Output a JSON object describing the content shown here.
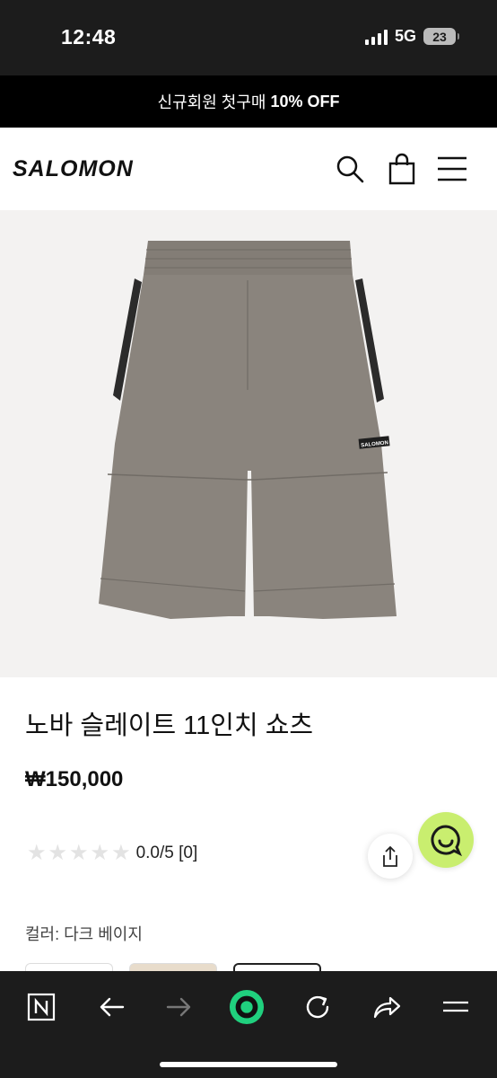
{
  "status_bar": {
    "time": "12:48",
    "network": "5G",
    "battery": "23"
  },
  "promo": {
    "text_ko": "신규회원 첫구매 ",
    "text_bold": "10% OFF"
  },
  "header": {
    "logo": "SALOMON",
    "icons": [
      "search-icon",
      "shopping-bag-icon",
      "menu-icon"
    ]
  },
  "product": {
    "image_logo": "SALOMON",
    "title": "노바 슬레이트 11인치 쇼츠",
    "price": "₩150,000",
    "rating": {
      "value": 0.0,
      "max": 5,
      "text": "0.0/5 [0]"
    },
    "color_label": "컬러: 다크 베이지"
  },
  "colors": {
    "brand_green": "#c9ee6f",
    "dark_bar": "#1c1c1c",
    "shorts_gray": "#8a847d"
  },
  "browser_bar": {
    "icons": [
      "naver-n-icon",
      "back-arrow-icon",
      "forward-arrow-icon",
      "green-dot-icon",
      "refresh-icon",
      "share-arrow-icon",
      "menu-icon"
    ]
  }
}
